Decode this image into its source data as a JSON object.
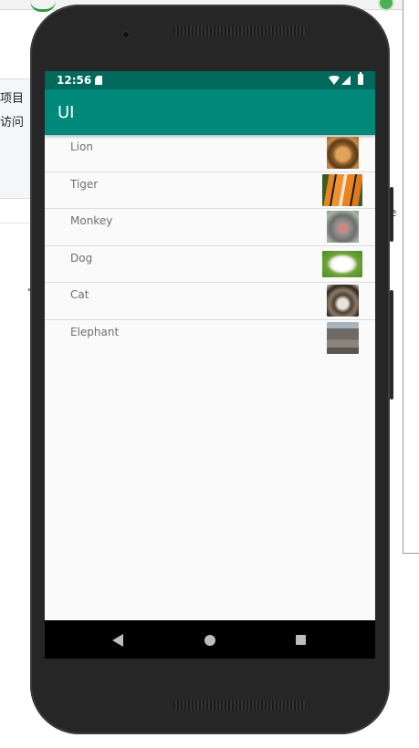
{
  "background": {
    "side_texts": [
      "项目",
      "访问"
    ],
    "right_fragment": "e"
  },
  "status_bar": {
    "time": "12:56"
  },
  "app_bar": {
    "title": "UI",
    "color": "#00897b",
    "status_color": "#00695c"
  },
  "animals": [
    {
      "name": "Lion",
      "icon": "lion-thumbnail"
    },
    {
      "name": "Tiger",
      "icon": "tiger-thumbnail"
    },
    {
      "name": "Monkey",
      "icon": "monkey-thumbnail"
    },
    {
      "name": "Dog",
      "icon": "dog-thumbnail"
    },
    {
      "name": "Cat",
      "icon": "cat-thumbnail"
    },
    {
      "name": "Elephant",
      "icon": "elephant-thumbnail"
    }
  ],
  "nav_bar": {
    "icons": [
      "back-icon",
      "home-icon",
      "recents-icon"
    ]
  }
}
